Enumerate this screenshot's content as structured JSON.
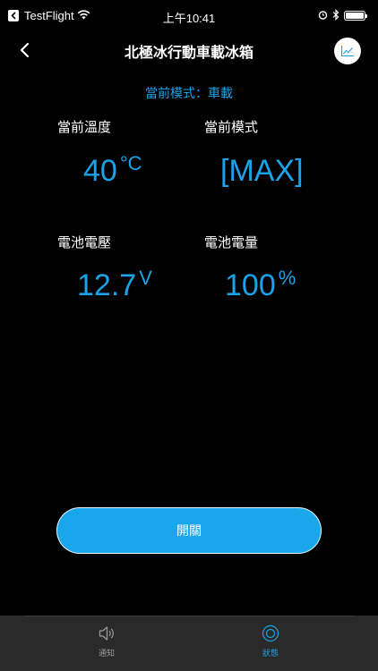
{
  "status_bar": {
    "back_app": "TestFlight",
    "time": "上午10:41"
  },
  "header": {
    "title": "北極冰行動車載冰箱",
    "chart_icon": "line-chart-icon"
  },
  "mode_line": "當前模式：車載",
  "stats": {
    "temperature": {
      "label": "當前溫度",
      "value": "40",
      "unit": "°C"
    },
    "mode": {
      "label": "當前模式",
      "value": "[MAX]"
    },
    "voltage": {
      "label": "電池電壓",
      "value": "12.7",
      "unit": "V"
    },
    "battery": {
      "label": "電池電量",
      "value": "100",
      "unit": "%"
    }
  },
  "power_button": {
    "label": "開關"
  },
  "tabs": [
    {
      "label": "通知",
      "icon": "speaker-icon",
      "active": false
    },
    {
      "label": "狀態",
      "icon": "status-ring-icon",
      "active": true
    }
  ],
  "colors": {
    "accent": "#1aa3e8",
    "background": "#000000",
    "tab_bar": "#2a2a2a"
  }
}
